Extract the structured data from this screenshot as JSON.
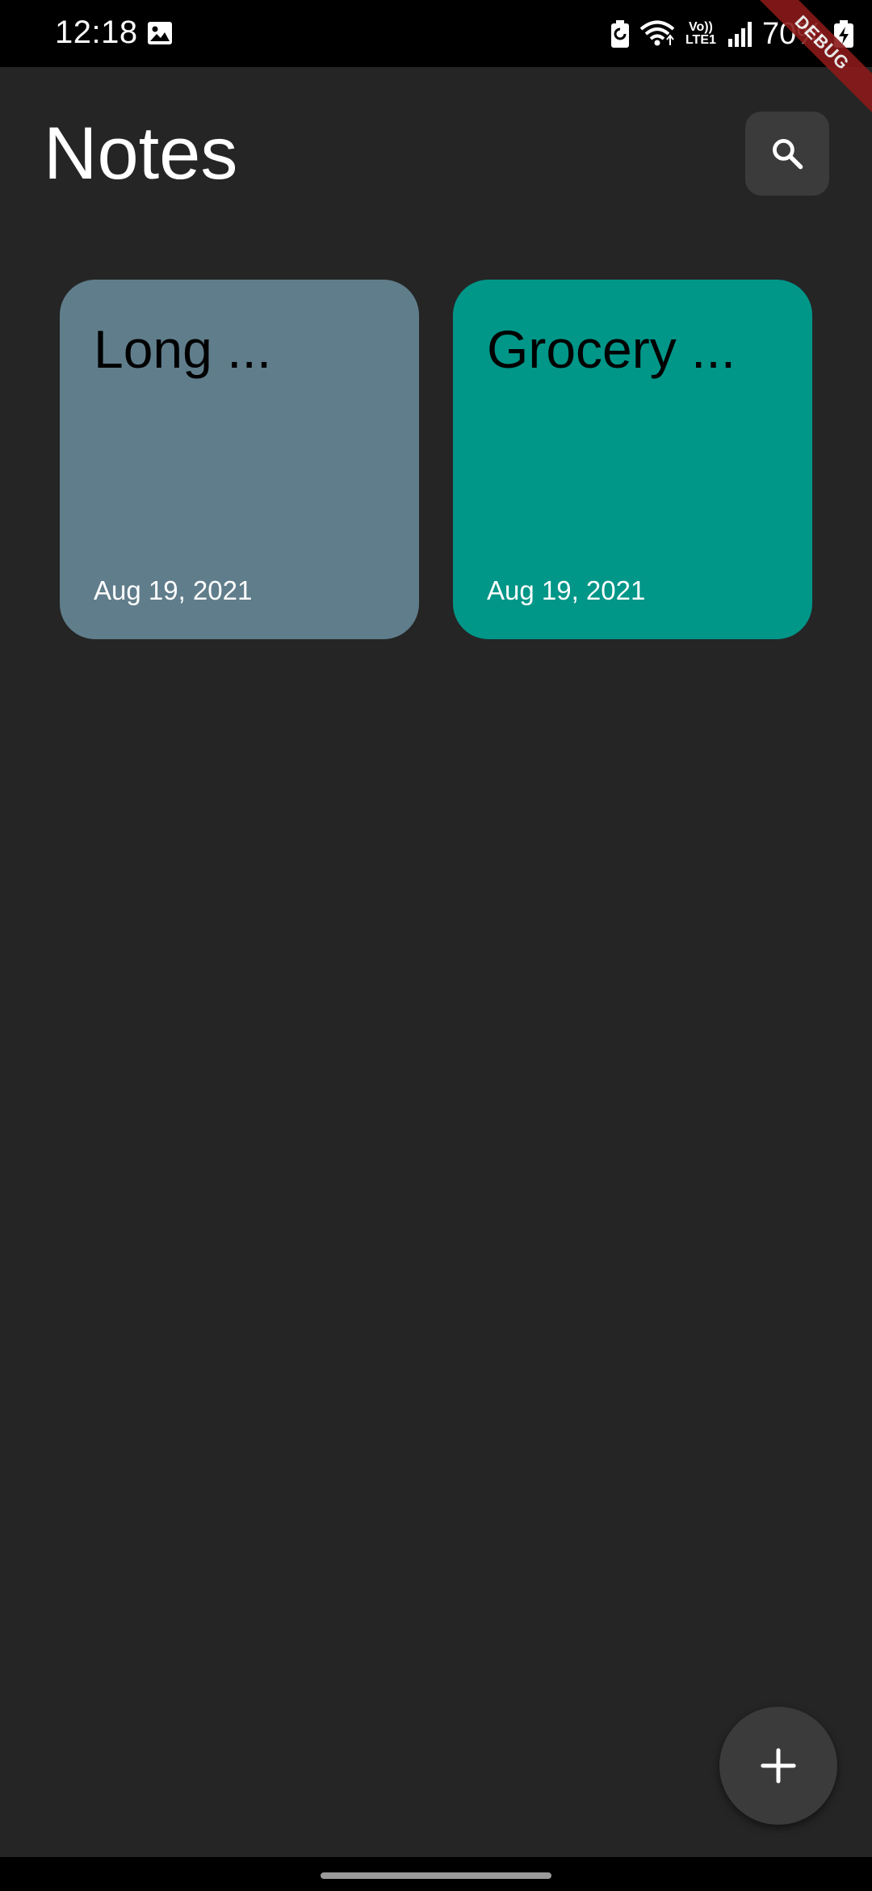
{
  "status_bar": {
    "time": "12:18",
    "volte_line1": "Vo))",
    "volte_line2": "LTE1",
    "battery": "70%"
  },
  "debug_banner": {
    "label": "DEBUG",
    "color": "#8b1a1a"
  },
  "header": {
    "title": "Notes",
    "search_icon": "search-icon"
  },
  "notes": [
    {
      "title": "Long ...",
      "date": "Aug 19, 2021",
      "color": "#607d8b"
    },
    {
      "title": "Grocery ...",
      "date": "Aug 19, 2021",
      "color": "#009688"
    }
  ],
  "fab": {
    "icon": "add-icon"
  },
  "colors": {
    "background": "#252525",
    "button": "#3b3b3b",
    "status_bar": "#000000"
  }
}
